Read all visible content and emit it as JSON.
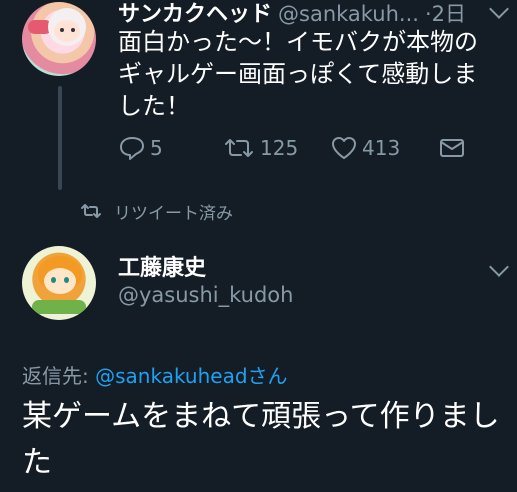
{
  "tweet1": {
    "name": "サンカクヘッド",
    "handle": "@sankakuh...",
    "dot": "·",
    "time": "2日",
    "text": "面白かった〜！イモバクが本物のギャルゲー画面っぽくて感動しました！",
    "actions": {
      "reply_count": "5",
      "retweet_count": "125",
      "like_count": "413"
    }
  },
  "retweet_marker": {
    "label": "リツイート済み"
  },
  "tweet2": {
    "name": "工藤康史",
    "handle": "@yasushi_kudoh",
    "reply_prefix": "返信先: ",
    "reply_mention": "@sankakuhead",
    "reply_suffix": "さん",
    "text": "某ゲームをまねて頑張って作りました"
  },
  "colors": {
    "background": "#141d26",
    "secondary_text": "#8899a6",
    "link": "#1da1f2"
  },
  "icons": [
    "reply-icon",
    "retweet-icon",
    "like-icon",
    "message-icon",
    "chevron-down-icon"
  ]
}
